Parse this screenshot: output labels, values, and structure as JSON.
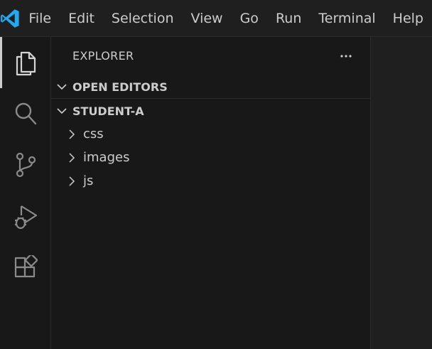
{
  "menubar": {
    "logo_icon": "vscode-logo-icon",
    "items": [
      "File",
      "Edit",
      "Selection",
      "View",
      "Go",
      "Run",
      "Terminal",
      "Help"
    ]
  },
  "activitybar": {
    "items": [
      {
        "icon": "files-icon",
        "active": true
      },
      {
        "icon": "search-icon",
        "active": false
      },
      {
        "icon": "source-control-icon",
        "active": false
      },
      {
        "icon": "run-debug-icon",
        "active": false
      },
      {
        "icon": "extensions-icon",
        "active": false
      }
    ]
  },
  "sidebar": {
    "title": "EXPLORER",
    "more_icon": "ellipsis-icon",
    "open_editors": {
      "label": "OPEN EDITORS",
      "expanded": false
    },
    "workspace": {
      "label": "STUDENT-A",
      "expanded": true,
      "folders": [
        "css",
        "images",
        "js"
      ]
    }
  },
  "colors": {
    "accent": "#0078d4",
    "logo": "#23a9f2",
    "text": "#cccccc",
    "sidebar_bg": "#181818",
    "editor_bg": "#1f1f1f"
  }
}
